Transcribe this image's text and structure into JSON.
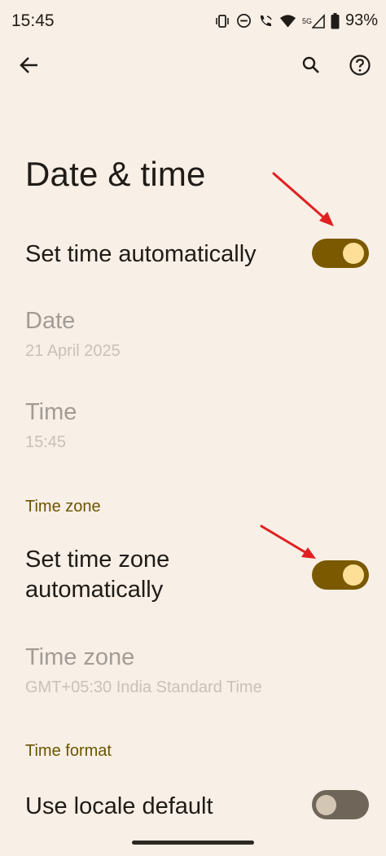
{
  "status_bar": {
    "time": "15:45",
    "network_label": "5G",
    "battery": "93%",
    "icons": [
      "vibrate-icon",
      "dnd-icon",
      "wifi-calling-icon",
      "wifi-icon",
      "signal-icon",
      "battery-icon"
    ]
  },
  "toolbar": {
    "back_icon": "arrow-back-icon",
    "search_icon": "search-icon",
    "help_icon": "help-icon"
  },
  "page": {
    "title": "Date & time"
  },
  "settings": {
    "set_time_auto": {
      "label": "Set time automatically",
      "enabled": true
    },
    "date": {
      "label": "Date",
      "value": "21 April 2025"
    },
    "time": {
      "label": "Time",
      "value": "15:45"
    },
    "time_zone_section": "Time zone",
    "set_tz_auto": {
      "label_line1": "Set time zone",
      "label_line2": "automatically",
      "enabled": true
    },
    "time_zone": {
      "label": "Time zone",
      "value": "GMT+05:30 India Standard Time"
    },
    "time_format_section": "Time format",
    "locale_default": {
      "label": "Use locale default",
      "enabled": false
    }
  },
  "colors": {
    "background": "#f8efe6",
    "accent": "#7a5900",
    "annotation_arrow": "#e02020"
  }
}
